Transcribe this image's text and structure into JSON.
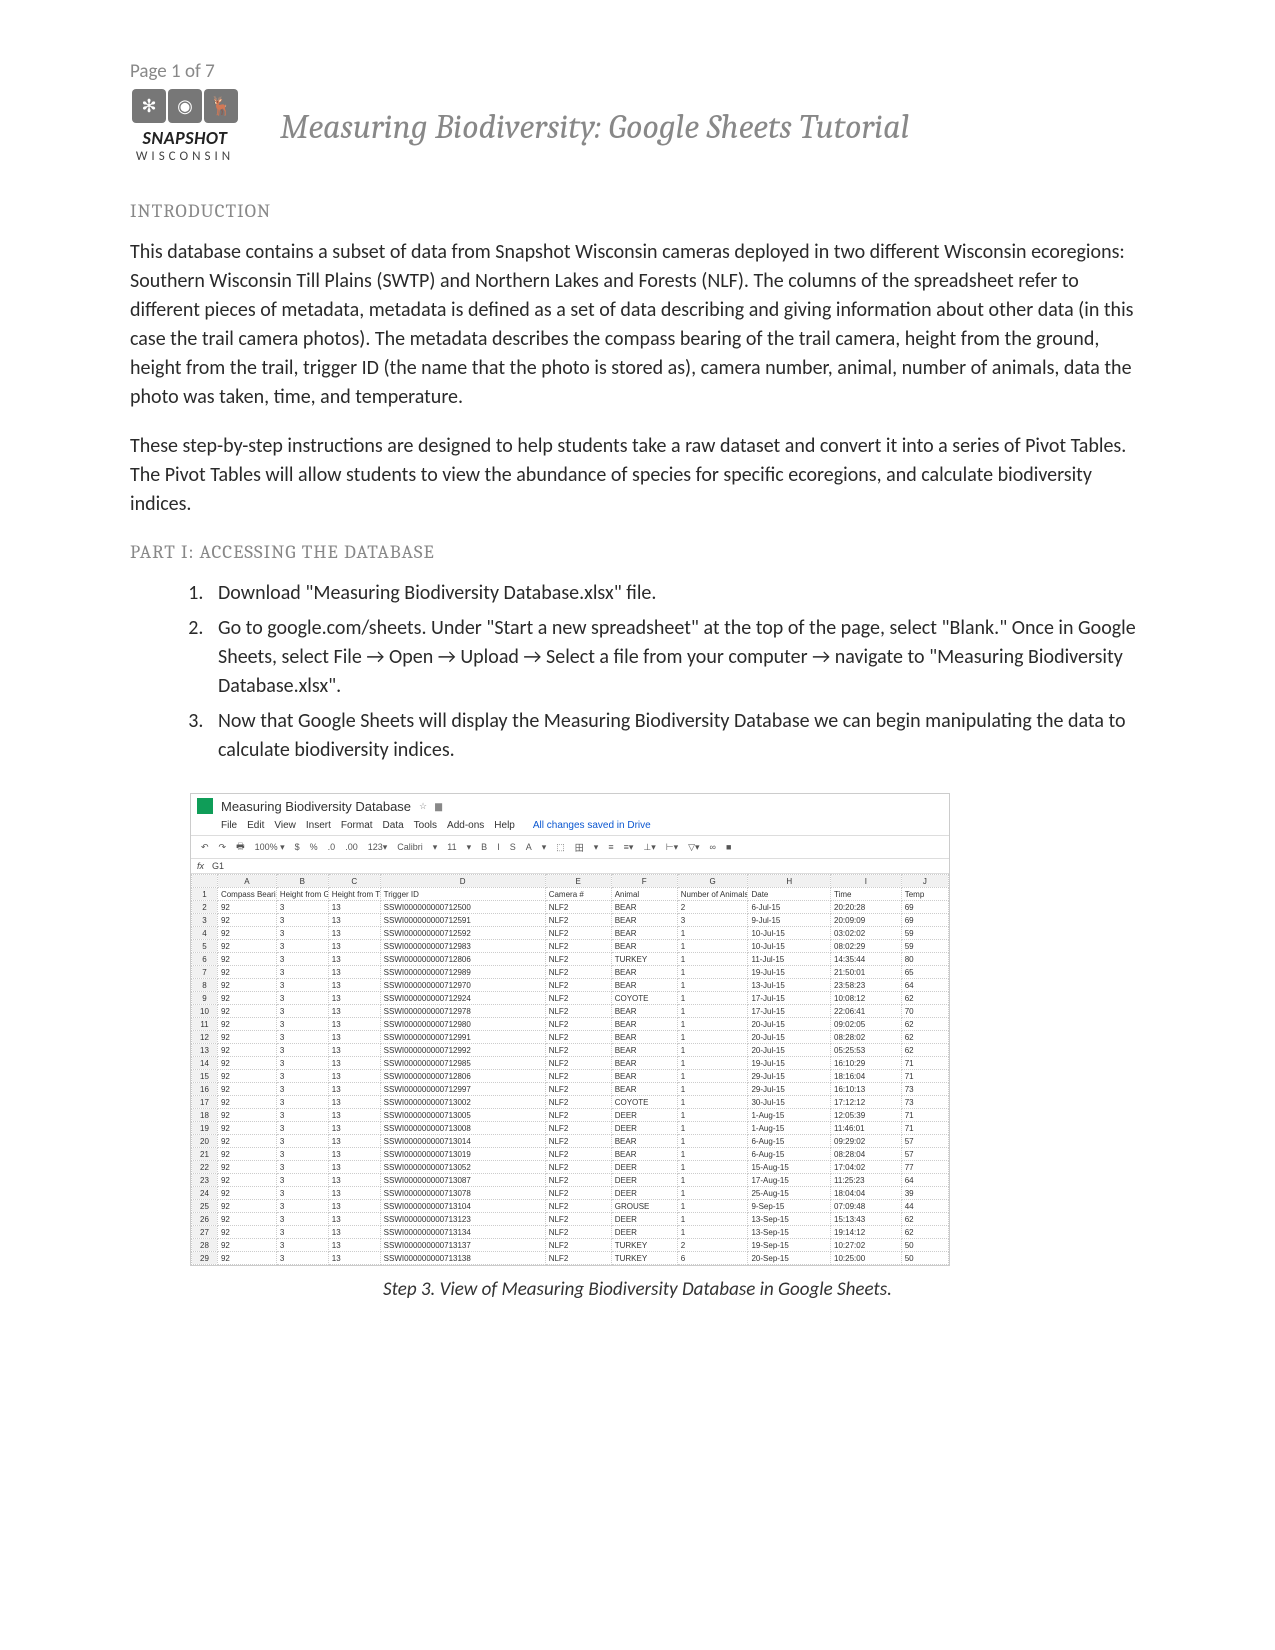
{
  "page_label": "Page 1 of 7",
  "logo": {
    "text1": "SNAPSHOT",
    "text2": "WISCONSIN"
  },
  "title": "Measuring Biodiversity: Google Sheets Tutorial",
  "section_intro": "INTRODUCTION",
  "para1": "This database contains a subset of data from Snapshot Wisconsin cameras deployed in two different Wisconsin ecoregions: Southern Wisconsin Till Plains (SWTP) and Northern Lakes and Forests (NLF). The columns of the spreadsheet refer to different pieces of metadata, metadata is defined as a set of data describing and giving information about other data (in this case the trail camera photos). The metadata describes the compass bearing of the trail camera, height from the ground, height from the trail, trigger ID (the name that the photo is stored as), camera number, animal, number of animals, data the photo was taken, time, and temperature.",
  "para2": "These step-by-step instructions are designed to help students take a raw dataset and convert it into a series of Pivot Tables. The Pivot Tables will allow students to view the abundance of species for specific ecoregions, and calculate biodiversity indices.",
  "section_part1": "PART I: ACCESSING THE DATABASE",
  "steps": [
    "Download \"Measuring Biodiversity Database.xlsx\" file.",
    "Go to google.com/sheets. Under \"Start a new spreadsheet\" at the top of the page, select \"Blank.\" Once in Google Sheets, select File → Open → Upload → Select a file from your computer → navigate to \"Measuring Biodiversity Database.xlsx\".",
    "Now that Google Sheets will display the Measuring Biodiversity Database we can begin manipulating the data to calculate biodiversity indices."
  ],
  "sheet": {
    "doc_title": "Measuring Biodiversity Database",
    "saved_text": "All changes saved in Drive",
    "menus": [
      "File",
      "Edit",
      "View",
      "Insert",
      "Format",
      "Data",
      "Tools",
      "Add-ons",
      "Help"
    ],
    "toolbar": [
      "↶",
      "↷",
      "🖶",
      "100% ▾",
      "$",
      "%",
      ".0",
      ".00",
      "123▾",
      "Calibri",
      "▾",
      "11",
      "▾",
      "B",
      "I",
      "S",
      "A",
      "▾",
      "⬚",
      "田",
      "▾",
      "≡",
      "≡▾",
      "⊥▾",
      "⊢▾",
      "▽▾",
      "∞",
      "■"
    ],
    "fx_label": "fx",
    "active_cell": "G1",
    "col_letters": [
      "",
      "A",
      "B",
      "C",
      "D",
      "E",
      "F",
      "G",
      "H",
      "I",
      "J"
    ],
    "headers": [
      "Compass Bearing",
      "Height from Ground",
      "Height from Trail",
      "Trigger ID",
      "Camera #",
      "Animal",
      "Number of Animals",
      "Date",
      "Time",
      "Temp"
    ],
    "rows": [
      [
        "92",
        "3",
        "13",
        "SSWI000000000712500",
        "NLF2",
        "BEAR",
        "2",
        "6-Jul-15",
        "20:20:28",
        "69"
      ],
      [
        "92",
        "3",
        "13",
        "SSWI000000000712591",
        "NLF2",
        "BEAR",
        "3",
        "9-Jul-15",
        "20:09:09",
        "69"
      ],
      [
        "92",
        "3",
        "13",
        "SSWI000000000712592",
        "NLF2",
        "BEAR",
        "1",
        "10-Jul-15",
        "03:02:02",
        "59"
      ],
      [
        "92",
        "3",
        "13",
        "SSWI000000000712983",
        "NLF2",
        "BEAR",
        "1",
        "10-Jul-15",
        "08:02:29",
        "59"
      ],
      [
        "92",
        "3",
        "13",
        "SSWI000000000712806",
        "NLF2",
        "TURKEY",
        "1",
        "11-Jul-15",
        "14:35:44",
        "80"
      ],
      [
        "92",
        "3",
        "13",
        "SSWI000000000712989",
        "NLF2",
        "BEAR",
        "1",
        "19-Jul-15",
        "21:50:01",
        "65"
      ],
      [
        "92",
        "3",
        "13",
        "SSWI000000000712970",
        "NLF2",
        "BEAR",
        "1",
        "13-Jul-15",
        "23:58:23",
        "64"
      ],
      [
        "92",
        "3",
        "13",
        "SSWI000000000712924",
        "NLF2",
        "COYOTE",
        "1",
        "17-Jul-15",
        "10:08:12",
        "62"
      ],
      [
        "92",
        "3",
        "13",
        "SSWI000000000712978",
        "NLF2",
        "BEAR",
        "1",
        "17-Jul-15",
        "22:06:41",
        "70"
      ],
      [
        "92",
        "3",
        "13",
        "SSWI000000000712980",
        "NLF2",
        "BEAR",
        "1",
        "20-Jul-15",
        "09:02:05",
        "62"
      ],
      [
        "92",
        "3",
        "13",
        "SSWI000000000712991",
        "NLF2",
        "BEAR",
        "1",
        "20-Jul-15",
        "08:28:02",
        "62"
      ],
      [
        "92",
        "3",
        "13",
        "SSWI000000000712992",
        "NLF2",
        "BEAR",
        "1",
        "20-Jul-15",
        "05:25:53",
        "62"
      ],
      [
        "92",
        "3",
        "13",
        "SSWI000000000712985",
        "NLF2",
        "BEAR",
        "1",
        "19-Jul-15",
        "16:10:29",
        "71"
      ],
      [
        "92",
        "3",
        "13",
        "SSWI000000000712806",
        "NLF2",
        "BEAR",
        "1",
        "29-Jul-15",
        "18:16:04",
        "71"
      ],
      [
        "92",
        "3",
        "13",
        "SSWI000000000712997",
        "NLF2",
        "BEAR",
        "1",
        "29-Jul-15",
        "16:10:13",
        "73"
      ],
      [
        "92",
        "3",
        "13",
        "SSWI000000000713002",
        "NLF2",
        "COYOTE",
        "1",
        "30-Jul-15",
        "17:12:12",
        "73"
      ],
      [
        "92",
        "3",
        "13",
        "SSWI000000000713005",
        "NLF2",
        "DEER",
        "1",
        "1-Aug-15",
        "12:05:39",
        "71"
      ],
      [
        "92",
        "3",
        "13",
        "SSWI000000000713008",
        "NLF2",
        "DEER",
        "1",
        "1-Aug-15",
        "11:46:01",
        "71"
      ],
      [
        "92",
        "3",
        "13",
        "SSWI000000000713014",
        "NLF2",
        "BEAR",
        "1",
        "6-Aug-15",
        "09:29:02",
        "57"
      ],
      [
        "92",
        "3",
        "13",
        "SSWI000000000713019",
        "NLF2",
        "BEAR",
        "1",
        "6-Aug-15",
        "08:28:04",
        "57"
      ],
      [
        "92",
        "3",
        "13",
        "SSWI000000000713052",
        "NLF2",
        "DEER",
        "1",
        "15-Aug-15",
        "17:04:02",
        "77"
      ],
      [
        "92",
        "3",
        "13",
        "SSWI000000000713087",
        "NLF2",
        "DEER",
        "1",
        "17-Aug-15",
        "11:25:23",
        "64"
      ],
      [
        "92",
        "3",
        "13",
        "SSWI000000000713078",
        "NLF2",
        "DEER",
        "1",
        "25-Aug-15",
        "18:04:04",
        "39"
      ],
      [
        "92",
        "3",
        "13",
        "SSWI000000000713104",
        "NLF2",
        "GROUSE",
        "1",
        "9-Sep-15",
        "07:09:48",
        "44"
      ],
      [
        "92",
        "3",
        "13",
        "SSWI000000000713123",
        "NLF2",
        "DEER",
        "1",
        "13-Sep-15",
        "15:13:43",
        "62"
      ],
      [
        "92",
        "3",
        "13",
        "SSWI000000000713134",
        "NLF2",
        "DEER",
        "1",
        "13-Sep-15",
        "19:14:12",
        "62"
      ],
      [
        "92",
        "3",
        "13",
        "SSWI000000000713137",
        "NLF2",
        "TURKEY",
        "2",
        "19-Sep-15",
        "10:27:02",
        "50"
      ],
      [
        "92",
        "3",
        "13",
        "SSWI000000000713138",
        "NLF2",
        "TURKEY",
        "6",
        "20-Sep-15",
        "10:25:00",
        "50"
      ]
    ]
  },
  "caption": "Step 3. View of Measuring Biodiversity Database in Google Sheets."
}
